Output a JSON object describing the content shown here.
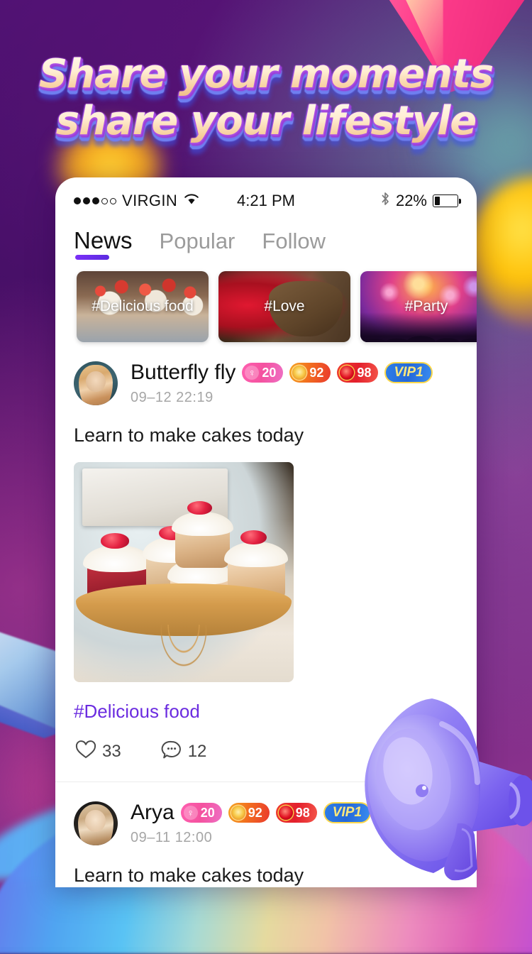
{
  "promo": {
    "headline_line1": "Share your moments",
    "headline_line2": "share your lifestyle",
    "accent_purple": "#7b2ff7",
    "accent_pink": "#ff3d8b"
  },
  "status_bar": {
    "carrier": "VIRGIN",
    "signal_dots_filled": 3,
    "signal_dots_total": 5,
    "wifi_icon": "wifi-icon",
    "time": "4:21 PM",
    "bluetooth_icon": "bluetooth-icon",
    "battery_percent": "22%",
    "battery_level": 22
  },
  "tabs": [
    {
      "label": "News",
      "active": true
    },
    {
      "label": "Popular",
      "active": false
    },
    {
      "label": "Follow",
      "active": false
    }
  ],
  "categories": [
    {
      "label": "#Delicious food",
      "art": "art-food"
    },
    {
      "label": "#Love",
      "art": "art-love"
    },
    {
      "label": "#Party",
      "art": "art-party"
    }
  ],
  "posts": [
    {
      "username": "Butterfly fly",
      "timestamp": "09–12  22:19",
      "badges": [
        {
          "type": "gender",
          "icon": "female-icon",
          "value": "20"
        },
        {
          "type": "level",
          "icon": "medal-icon",
          "value": "92"
        },
        {
          "type": "rich",
          "icon": "gem-icon",
          "value": "98"
        },
        {
          "type": "vip",
          "icon": "vip-icon",
          "value": "VIP1"
        }
      ],
      "text": "Learn to make cakes today",
      "image_alt": "raspberry-cupcakes-on-gold-cake-stand",
      "hashtag": "#Delicious food",
      "likes": "33",
      "comments": "12",
      "like_icon": "heart-icon",
      "comment_icon": "comment-icon"
    },
    {
      "username": "Arya",
      "timestamp": "09–11  12:00",
      "badges": [
        {
          "type": "gender",
          "icon": "female-icon",
          "value": "20"
        },
        {
          "type": "level",
          "icon": "medal-icon",
          "value": "92"
        },
        {
          "type": "rich",
          "icon": "gem-icon",
          "value": "98"
        },
        {
          "type": "vip",
          "icon": "vip-icon",
          "value": "VIP1"
        }
      ],
      "text": "Learn to make cakes today"
    }
  ],
  "decorations": {
    "megaphone": "megaphone-icon",
    "prism": "prism-shape",
    "ribbon": "ribbon-shape"
  }
}
